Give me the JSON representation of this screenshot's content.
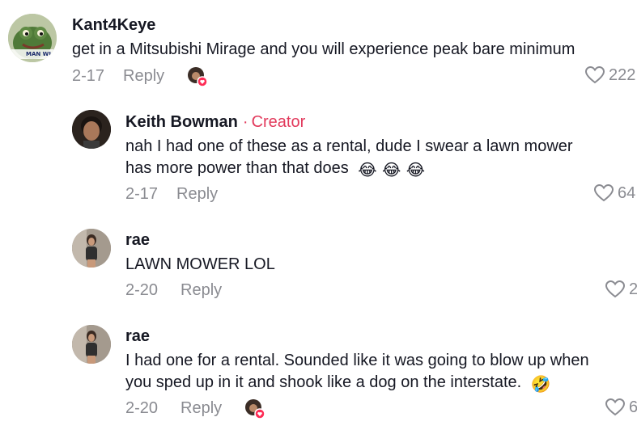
{
  "comments": [
    {
      "username": "Kant4Keye",
      "avatar": "frog-avatar",
      "avatar_text": "MAN WI",
      "text": "get in a Mitsubishi Mirage and you will experience peak bare minimum",
      "date": "2-17",
      "reply_label": "Reply",
      "likes": "222",
      "liked_by_creator": true
    },
    {
      "username": "Keith Bowman",
      "creator_label": "Creator",
      "avatar": "person-avatar",
      "text_line1": "nah I had one of these as a rental, dude I swear a lawn mower",
      "text_line2": "has more power than that does",
      "emoji": "😂 😂 😂",
      "date": "2-17",
      "reply_label": "Reply",
      "likes": "64"
    },
    {
      "username": "rae",
      "avatar": "person-avatar",
      "text": "LAWN MOWER LOL",
      "date": "2-20",
      "reply_label": "Reply",
      "likes": "2"
    },
    {
      "username": "rae",
      "avatar": "person-avatar",
      "text_line1": "I had one for a rental. Sounded like it was going to blow up when",
      "text_line2": "you sped up in it and shook like a dog on the interstate.",
      "emoji": "🤣",
      "date": "2-20",
      "reply_label": "Reply",
      "likes": "6",
      "liked_by_creator": true
    }
  ],
  "colors": {
    "text": "#161823",
    "muted": "#8a8b91",
    "accent": "#e23a5c"
  }
}
